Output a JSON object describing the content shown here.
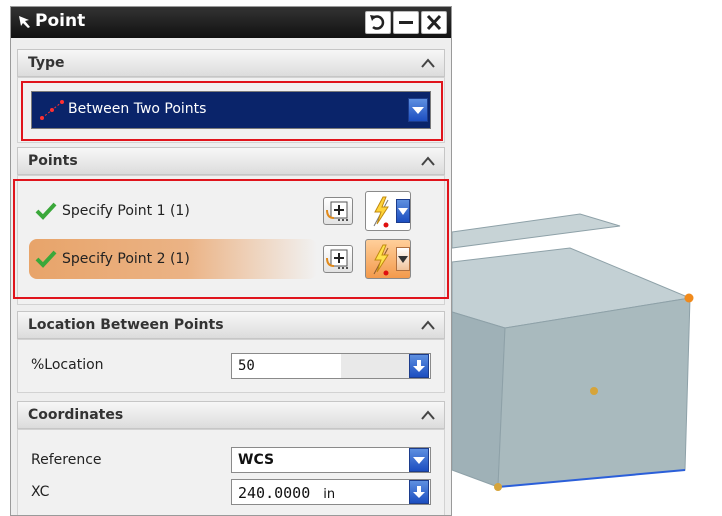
{
  "dialog": {
    "title": "Point",
    "type_section": {
      "heading": "Type",
      "selected": "Between Two Points"
    },
    "points_section": {
      "heading": "Points",
      "point1_label": "Specify Point 1 (1)",
      "point2_label": "Specify Point 2 (1)"
    },
    "location_section": {
      "heading": "Location Between Points",
      "location_label": "%Location",
      "location_value": "50"
    },
    "coordinates_section": {
      "heading": "Coordinates",
      "reference_label": "Reference",
      "reference_value": "WCS",
      "xc_label": "XC",
      "xc_value": "240.0000",
      "xc_unit": "in"
    }
  },
  "icons": {
    "title_arrow": "select-arrow-icon",
    "reset": "reset-icon",
    "minimize": "minimize-icon",
    "close": "close-icon",
    "collapse": "chevron-up-icon",
    "check": "check-icon",
    "point_dialog": "point-dialog-icon",
    "snap": "inferred-point-icon"
  },
  "colors": {
    "highlight_box": "#e0141c",
    "type_select_bg": "#0a246a",
    "active_row": "#e8a46a",
    "model_face": "#b5c4c8",
    "selected_vertex": "#f08a1c",
    "edge_highlight": "#2b5fd9"
  }
}
